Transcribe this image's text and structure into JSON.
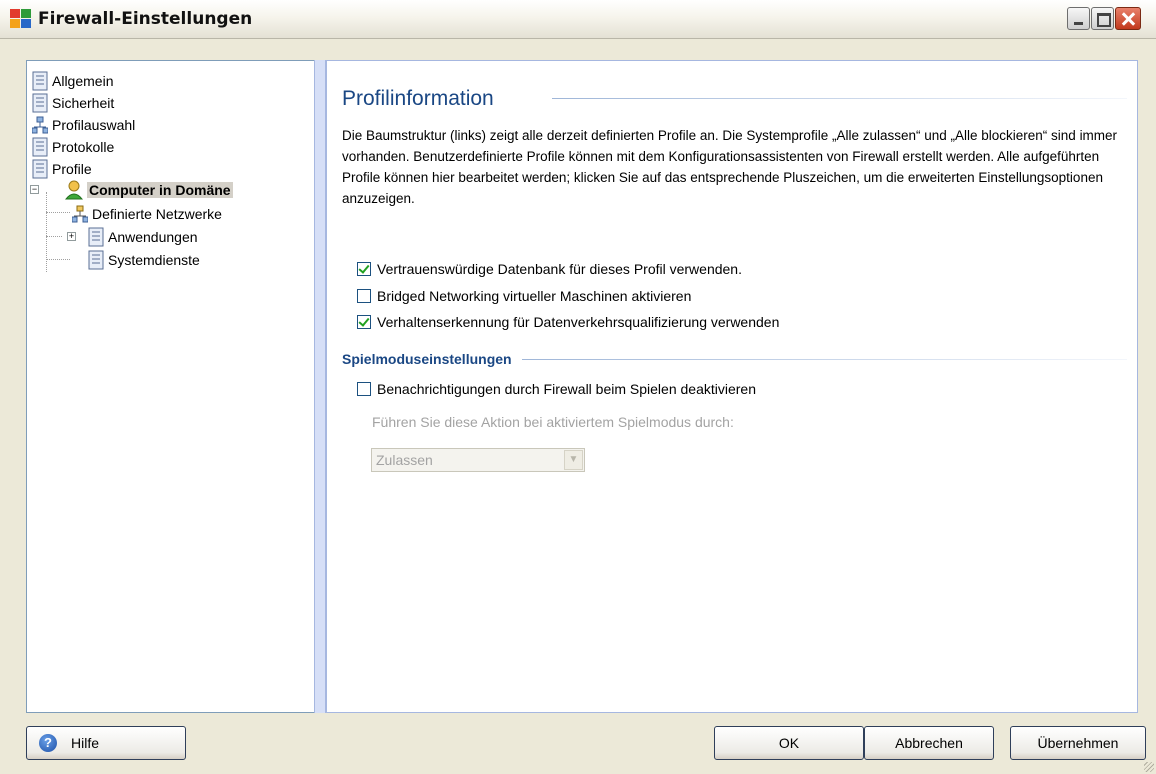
{
  "window": {
    "title": "Firewall-Einstellungen",
    "controls": [
      "minimize",
      "maximize",
      "close"
    ]
  },
  "tree": {
    "items": [
      {
        "label": "Allgemein",
        "icon": "document-list-icon"
      },
      {
        "label": "Sicherheit",
        "icon": "document-list-icon"
      },
      {
        "label": "Profilauswahl",
        "icon": "network-icon"
      },
      {
        "label": "Protokolle",
        "icon": "document-list-icon"
      },
      {
        "label": "Profile",
        "icon": "document-list-icon"
      },
      {
        "label": "Computer in Domäne",
        "icon": "user-icon",
        "selected": true,
        "expanded": true
      },
      {
        "label": "Definierte Netzwerke",
        "icon": "network-icon"
      },
      {
        "label": "Anwendungen",
        "icon": "document-list-icon",
        "expanded": false
      },
      {
        "label": "Systemdienste",
        "icon": "document-list-icon"
      }
    ]
  },
  "main": {
    "title": "Profilinformation",
    "description": "Die Baumstruktur (links) zeigt alle derzeit definierten Profile an. Die Systemprofile „Alle zulassen“ und „Alle blockieren“ sind immer vorhanden. Benutzerdefinierte Profile können mit dem Konfigurationsassistenten von Firewall erstellt werden. Alle aufgeführten Profile können hier bearbeitet werden; klicken Sie auf das entsprechende Pluszeichen, um die erweiterten Einstellungsoptionen anzuzeigen.",
    "options": [
      {
        "label": "Vertrauenswürdige Datenbank für dieses Profil verwenden.",
        "checked": true
      },
      {
        "label": "Bridged Networking virtueller Maschinen aktivieren",
        "checked": false
      },
      {
        "label": "Verhaltenserkennung für Datenverkehrsqualifizierung verwenden",
        "checked": true
      }
    ],
    "game_mode": {
      "title": "Spielmoduseinstellungen",
      "option": {
        "label": "Benachrichtigungen durch Firewall beim Spielen deaktivieren",
        "checked": false
      },
      "hint": "Führen Sie diese Aktion bei aktiviertem Spielmodus durch:",
      "select_value": "Zulassen",
      "disabled": true
    }
  },
  "buttons": {
    "help": "Hilfe",
    "ok": "OK",
    "cancel": "Abbrechen",
    "apply": "Übernehmen"
  },
  "colors": {
    "accent": "#1a4784",
    "check": "#21a121",
    "selected_bg": "#d4d0c8"
  }
}
